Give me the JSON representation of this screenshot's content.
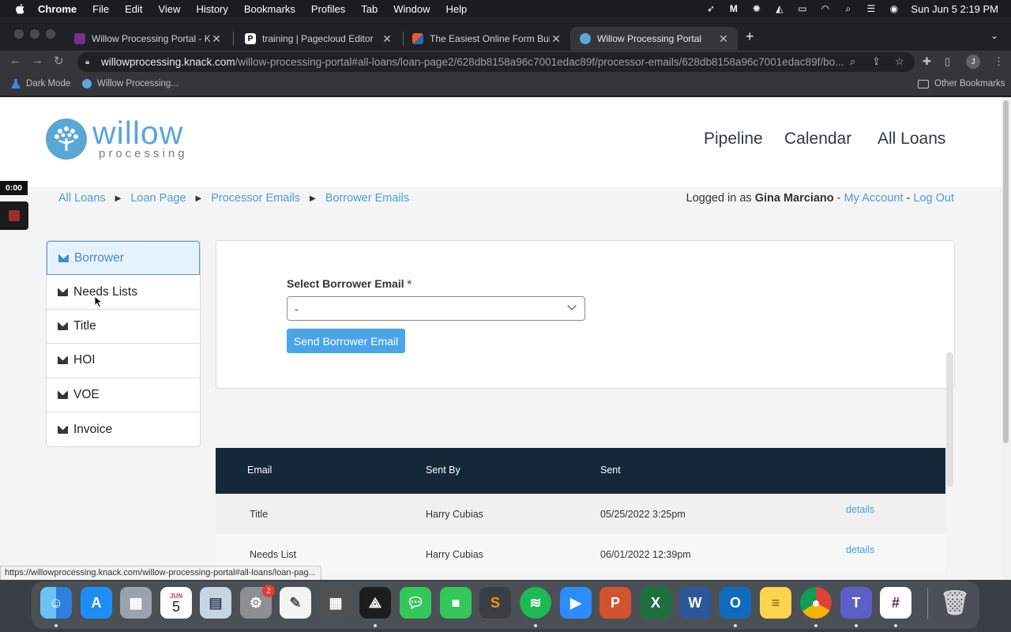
{
  "menubar": {
    "app": "Chrome",
    "items": [
      "File",
      "Edit",
      "View",
      "History",
      "Bookmarks",
      "Profiles",
      "Tab",
      "Window",
      "Help"
    ],
    "datetime": "Sun Jun 5  2:19 PM"
  },
  "tabs": [
    {
      "title": "Willow Processing Portal - Kna",
      "favicon_color": "#7b2f8c"
    },
    {
      "title": "training | Pagecloud Editor",
      "favicon_color": "#ffffff"
    },
    {
      "title": "The Easiest Online Form Builde",
      "favicon_color": "#f05a28"
    },
    {
      "title": "Willow Processing Portal",
      "favicon_color": "#5aa6d6"
    }
  ],
  "address": {
    "host": "willowprocessing.knack.com",
    "path": "/willow-processing-portal#all-loans/loan-page2/628db8158a96c7001edac89f/processor-emails/628db8158a96c7001edac89f/bo..."
  },
  "profile_initial": "J",
  "bookmarks": {
    "items": [
      "Dark Mode",
      "Willow Processing..."
    ],
    "other": "Other Bookmarks"
  },
  "logo": {
    "word": "willow",
    "sub": "processing"
  },
  "nav": [
    "Pipeline",
    "Calendar",
    "All Loans"
  ],
  "breadcrumb": [
    "All Loans",
    "Loan Page",
    "Processor Emails",
    "Borrower Emails"
  ],
  "login": {
    "prefix": "Logged in as",
    "user": "Gina Marciano",
    "dash": "-",
    "my_account": "My Account",
    "logout": "Log Out"
  },
  "sidemenu": [
    "Borrower",
    "Needs Lists",
    "Title",
    "HOI",
    "VOE",
    "Invoice"
  ],
  "form": {
    "label": "Select Borrower Email",
    "required_mark": "*",
    "select_value": "-",
    "button": "Send Borrower Email"
  },
  "table": {
    "headers": [
      "Email",
      "Sent By",
      "Sent"
    ],
    "rows": [
      {
        "email": "Title",
        "sent_by": "Harry Cubias",
        "sent": "05/25/2022 3:25pm",
        "link": "details"
      },
      {
        "email": "Needs List",
        "sent_by": "Harry Cubias",
        "sent": "06/01/2022 12:39pm",
        "link": "details"
      }
    ]
  },
  "recording": {
    "time": "0:00"
  },
  "status_url": "https://willowprocessing.knack.com/willow-processing-portal#all-loans/loan-pag...",
  "dock": {
    "calendar_month": "JUN",
    "calendar_day": "5",
    "settings_badge": "2",
    "apps": [
      "finder-icon",
      "app-store-icon",
      "launchpad-icon",
      "calendar-icon",
      "preview-icon",
      "system-preferences-icon",
      "textedit-icon",
      "calculator-icon",
      "acrobat-icon",
      "messages-icon",
      "facetime-icon",
      "sublime-icon",
      "spotify-icon",
      "zoom-icon",
      "powerpoint-icon",
      "excel-icon",
      "word-icon",
      "outlook-icon",
      "notes-icon",
      "chrome-icon",
      "teams-icon",
      "slack-icon"
    ]
  },
  "colors": {
    "brand_blue": "#4a9fd8",
    "table_header": "#14283a",
    "button": "#4aa4e8",
    "required": "#d9363e"
  }
}
